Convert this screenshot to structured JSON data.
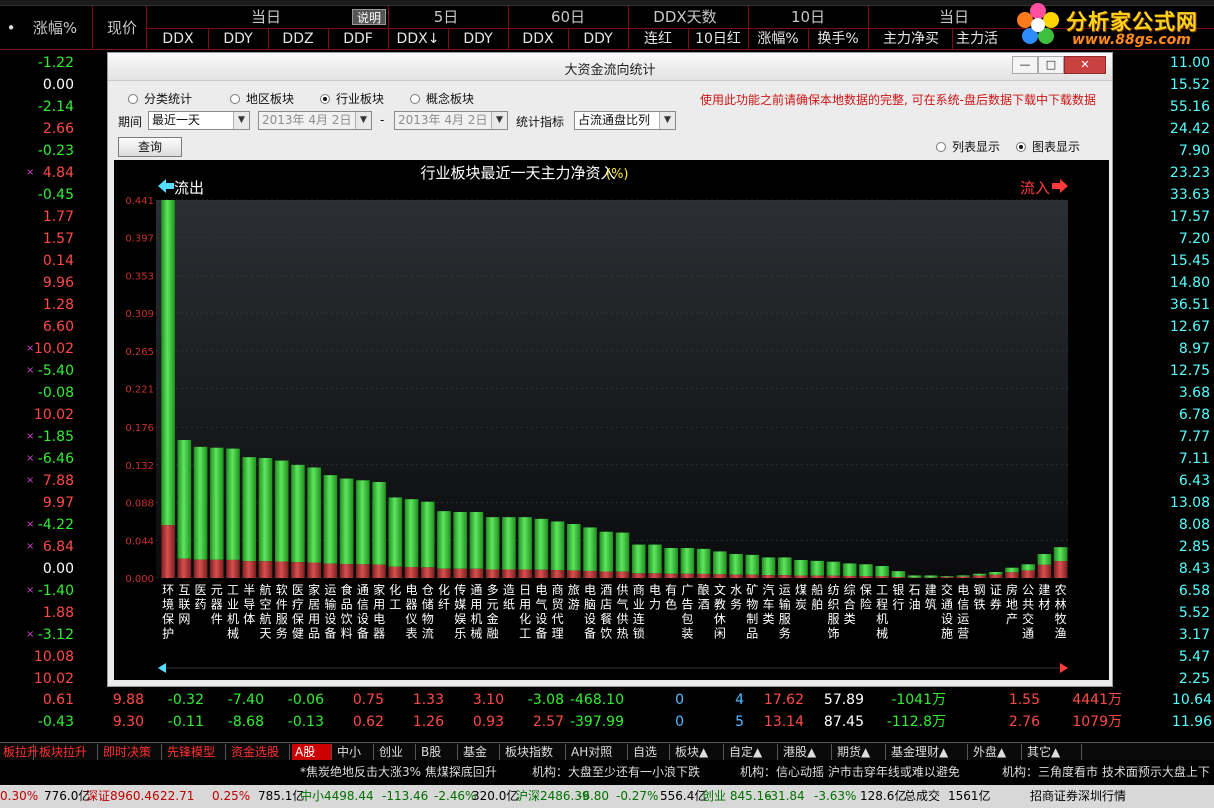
{
  "logo": {
    "title": "分析家公式网",
    "url": "www.88gs.com"
  },
  "table_header": {
    "change_pct": "涨幅%",
    "price": "现价",
    "explain_btn": "说明",
    "groups": [
      {
        "label": "当日",
        "subs": [
          "DDX",
          "DDY",
          "DDZ",
          "DDF"
        ]
      },
      {
        "label": "5日",
        "subs": [
          "DDX↓",
          "DDY"
        ]
      },
      {
        "label": "60日",
        "subs": [
          "DDX",
          "DDY"
        ]
      },
      {
        "label": "DDX天数",
        "subs": [
          "连红",
          "10日红"
        ]
      },
      {
        "label": "10日",
        "subs": [
          "涨幅%",
          "换手%"
        ]
      },
      {
        "label": "当日",
        "subs": [
          "主力净买",
          "主力活"
        ]
      }
    ]
  },
  "left_rows": [
    {
      "mark": "",
      "pct": "-1.22",
      "color": "#33ee33"
    },
    {
      "mark": "",
      "pct": "0.00",
      "color": "#ffffff"
    },
    {
      "mark": "",
      "pct": "-2.14",
      "color": "#33ee33"
    },
    {
      "mark": "",
      "pct": "2.66",
      "color": "#ff4a4a"
    },
    {
      "mark": "",
      "pct": "-0.23",
      "color": "#33ee33"
    },
    {
      "mark": "×",
      "pct": "4.84",
      "color": "#ff4a4a"
    },
    {
      "mark": "",
      "pct": "-0.45",
      "color": "#33ee33"
    },
    {
      "mark": "",
      "pct": "1.77",
      "color": "#ff4a4a"
    },
    {
      "mark": "",
      "pct": "1.57",
      "color": "#ff4a4a"
    },
    {
      "mark": "",
      "pct": "0.14",
      "color": "#ff4a4a"
    },
    {
      "mark": "",
      "pct": "9.96",
      "color": "#ff4a4a"
    },
    {
      "mark": "",
      "pct": "1.28",
      "color": "#ff4a4a"
    },
    {
      "mark": "",
      "pct": "6.60",
      "color": "#ff4a4a"
    },
    {
      "mark": "×",
      "pct": "10.02",
      "color": "#ff4a4a"
    },
    {
      "mark": "×",
      "pct": "-5.40",
      "color": "#33ee33"
    },
    {
      "mark": "",
      "pct": "-0.08",
      "color": "#33ee33"
    },
    {
      "mark": "",
      "pct": "10.02",
      "color": "#ff4a4a"
    },
    {
      "mark": "×",
      "pct": "-1.85",
      "color": "#33ee33"
    },
    {
      "mark": "×",
      "pct": "-6.46",
      "color": "#33ee33"
    },
    {
      "mark": "×",
      "pct": "7.88",
      "color": "#ff4a4a"
    },
    {
      "mark": "",
      "pct": "9.97",
      "color": "#ff4a4a"
    },
    {
      "mark": "×",
      "pct": "-4.22",
      "color": "#33ee33"
    },
    {
      "mark": "×",
      "pct": "6.84",
      "color": "#ff4a4a"
    },
    {
      "mark": "",
      "pct": "0.00",
      "color": "#ffffff"
    },
    {
      "mark": "×",
      "pct": "-1.40",
      "color": "#33ee33"
    },
    {
      "mark": "",
      "pct": "1.88",
      "color": "#ff4a4a"
    },
    {
      "mark": "×",
      "pct": "-3.12",
      "color": "#33ee33"
    },
    {
      "mark": "",
      "pct": "10.08",
      "color": "#ff4a4a"
    },
    {
      "mark": "",
      "pct": "10.02",
      "color": "#ff4a4a"
    }
  ],
  "right_rows": [
    {
      "v": "11.00"
    },
    {
      "v": "15.52"
    },
    {
      "v": "55.16"
    },
    {
      "v": "24.42"
    },
    {
      "v": "7.90"
    },
    {
      "v": "23.23"
    },
    {
      "v": "33.63"
    },
    {
      "v": "17.57"
    },
    {
      "v": "7.20"
    },
    {
      "v": "15.45"
    },
    {
      "v": "14.80"
    },
    {
      "v": "36.51"
    },
    {
      "v": "12.67"
    },
    {
      "v": "8.97"
    },
    {
      "v": "12.75"
    },
    {
      "v": "3.68"
    },
    {
      "v": "6.78"
    },
    {
      "v": "7.77"
    },
    {
      "v": "7.11"
    },
    {
      "v": "6.43"
    },
    {
      "v": "13.08"
    },
    {
      "v": "8.08"
    },
    {
      "v": "2.85"
    },
    {
      "v": "8.43"
    },
    {
      "v": "6.58"
    },
    {
      "v": "5.52"
    },
    {
      "v": "3.17"
    },
    {
      "v": "5.47"
    },
    {
      "v": "2.25"
    }
  ],
  "bottom_rows": [
    {
      "c1": "0.61",
      "c2": "9.88",
      "c3": "-0.32",
      "c4": "-7.40",
      "c5": "-0.06",
      "c6": "0.75",
      "c7": "1.33",
      "c8": "3.10",
      "c9": "-3.08",
      "c10": "-468.10",
      "c11": "0",
      "c12": "4",
      "c13": "17.62",
      "c14": "57.89",
      "c15": "-1041万",
      "c16": "1.55",
      "c17": "4441万",
      "c18": "10.64"
    },
    {
      "c1": "-0.43",
      "c2": "9.30",
      "c3": "-0.11",
      "c4": "-8.68",
      "c5": "-0.13",
      "c6": "0.62",
      "c7": "1.26",
      "c8": "0.93",
      "c9": "2.57",
      "c10": "-397.99",
      "c11": "0",
      "c12": "5",
      "c13": "13.14",
      "c14": "87.45",
      "c15": "-112.8万",
      "c16": "2.76",
      "c17": "1079万",
      "c18": "11.96"
    }
  ],
  "tabs": [
    "板拉升",
    "板块拉升",
    "即时决策",
    "先锋模型",
    "资金选股",
    "A股",
    "中小",
    "创业",
    "B股",
    "基金",
    "板块指数",
    "AH对照",
    "自选",
    "板块▲",
    "自定▲",
    "港股▲",
    "期货▲",
    "基金理财▲",
    "外盘▲",
    "其它▲"
  ],
  "ticker": [
    "*焦炭绝地反击大涨3% 焦煤探底回升",
    "机构：大盘至少还有一小浪下跌",
    "机构：信心动摇 沪市击穿年线或难以避免",
    "机构：三角度看市 技术面预示大盘上下"
  ],
  "status": [
    {
      "t": "0.30%",
      "c": "#c00000"
    },
    {
      "t": "776.0亿",
      "c": "#000"
    },
    {
      "t": "深证8960.46",
      "c": "#c00000"
    },
    {
      "t": "22.71",
      "c": "#c00000"
    },
    {
      "t": "0.25%",
      "c": "#c00000"
    },
    {
      "t": "785.1亿",
      "c": "#000"
    },
    {
      "t": "中小4498.44",
      "c": "#007000"
    },
    {
      "t": "-113.46",
      "c": "#007000"
    },
    {
      "t": "-2.46%",
      "c": "#007000"
    },
    {
      "t": "320.0亿",
      "c": "#000"
    },
    {
      "t": "沪深2486.39",
      "c": "#007000"
    },
    {
      "t": "-6.80",
      "c": "#007000"
    },
    {
      "t": "-0.27%",
      "c": "#007000"
    },
    {
      "t": "556.4亿",
      "c": "#000"
    },
    {
      "t": "创业 845.16",
      "c": "#007000"
    },
    {
      "t": "-31.84",
      "c": "#007000"
    },
    {
      "t": "-3.63%",
      "c": "#007000"
    },
    {
      "t": "128.6亿",
      "c": "#000"
    },
    {
      "t": "总成交",
      "c": "#000"
    },
    {
      "t": "1561亿",
      "c": "#000"
    },
    {
      "t": "招商证券深圳行情",
      "c": "#000"
    }
  ],
  "dialog": {
    "title": "大资金流向统计",
    "radios": [
      {
        "label": "分类统计",
        "checked": false
      },
      {
        "label": "地区板块",
        "checked": false
      },
      {
        "label": "行业板块",
        "checked": true
      },
      {
        "label": "概念板块",
        "checked": false
      }
    ],
    "warning": "使用此功能之前请确保本地数据的完整, 可在系统-盘后数据下载中下载数据",
    "period_label": "期间",
    "period_value": "最近一天",
    "date_from": "2013年 4月 2日",
    "date_sep": "-",
    "date_to": "2013年 4月 2日",
    "metric_label": "统计指标",
    "metric_value": "占流通盘比列",
    "query_label": "查询",
    "view_list": "列表显示",
    "view_chart": "图表显示"
  },
  "colors": {
    "inflow": "#ff3a3a",
    "outflow": "#ff3a3a",
    "bar_green": "#33cc33",
    "bar_red": "#b83a3a",
    "tick": "#c83030"
  },
  "chart_data": {
    "type": "bar",
    "title": "行业板块最近一天主力净资入",
    "title_unit": "(%)",
    "outflow_label": "流出",
    "inflow_label": "流入",
    "ylim": [
      0,
      0.441
    ],
    "yticks": [
      "0.441",
      "0.397",
      "0.353",
      "0.309",
      "0.265",
      "0.221",
      "0.176",
      "0.132",
      "0.088",
      "0.044",
      "0.000"
    ],
    "categories": [
      "环境保护",
      "互联网",
      "医药",
      "元器件",
      "工业机械",
      "半导体",
      "航空航天",
      "软件服务",
      "医疗保健",
      "家居用品",
      "运输设备",
      "食品饮料",
      "通信设备",
      "家用电器",
      "化工",
      "电器仪表",
      "仓储物流",
      "化纤",
      "传媒娱乐",
      "通用机械",
      "多元金融",
      "造纸",
      "日用化工",
      "电气设备",
      "商贸代理",
      "旅游",
      "电脑设备",
      "酒店餐饮",
      "供气供热",
      "商业连锁",
      "电力",
      "有色",
      "广告包装",
      "酿酒",
      "文教休闲",
      "水务",
      "矿物制品",
      "汽车类",
      "运输服务",
      "煤炭",
      "船舶",
      "纺织服饰",
      "综合类",
      "保险",
      "工程机械",
      "银行",
      "石油",
      "建筑",
      "交通设施",
      "电信运营",
      "钢铁",
      "证券",
      "房地产",
      "公共交通",
      "建材",
      "农林牧渔"
    ],
    "values": [
      0.441,
      0.161,
      0.153,
      0.152,
      0.151,
      0.141,
      0.14,
      0.137,
      0.132,
      0.129,
      0.12,
      0.116,
      0.114,
      0.112,
      0.094,
      0.092,
      0.089,
      0.078,
      0.077,
      0.077,
      0.071,
      0.071,
      0.071,
      0.069,
      0.066,
      0.063,
      0.059,
      0.054,
      0.053,
      0.039,
      0.039,
      0.035,
      0.035,
      0.034,
      0.031,
      0.028,
      0.027,
      0.024,
      0.024,
      0.021,
      0.02,
      0.019,
      0.017,
      0.016,
      0.014,
      0.008,
      0.003,
      0.003,
      0.002,
      0.003,
      0.005,
      0.007,
      0.012,
      0.016,
      0.028,
      0.036
    ],
    "direction": [
      "out",
      "out",
      "out",
      "out",
      "out",
      "out",
      "out",
      "out",
      "out",
      "out",
      "out",
      "out",
      "out",
      "out",
      "out",
      "out",
      "out",
      "out",
      "out",
      "out",
      "out",
      "out",
      "out",
      "out",
      "out",
      "out",
      "out",
      "out",
      "out",
      "out",
      "out",
      "out",
      "out",
      "out",
      "out",
      "out",
      "out",
      "out",
      "out",
      "out",
      "out",
      "out",
      "out",
      "out",
      "out",
      "out",
      "out",
      "out",
      "in",
      "in",
      "in",
      "in",
      "in",
      "in",
      "in",
      "in"
    ]
  }
}
